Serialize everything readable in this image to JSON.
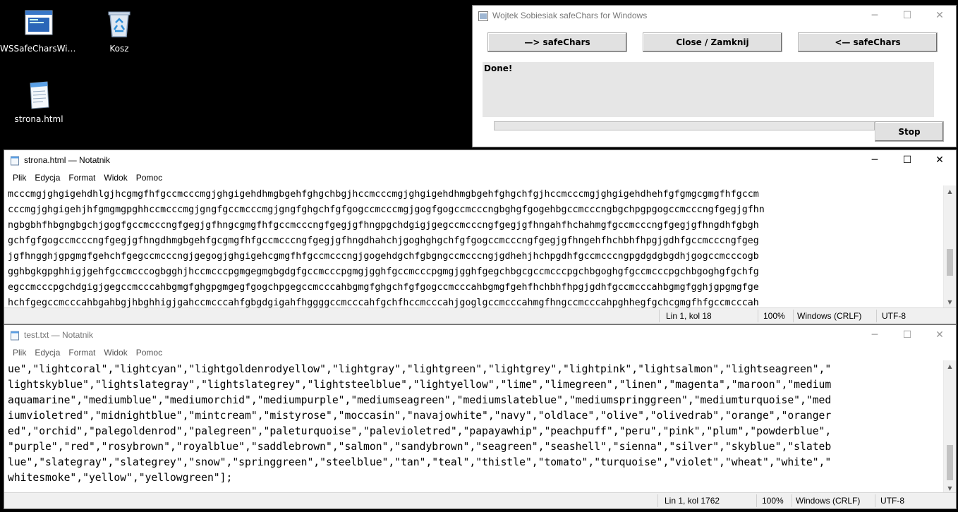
{
  "desktop": {
    "icons": [
      {
        "label": "WSSafeCharsWin...",
        "icon": "program-window-icon"
      },
      {
        "label": "Kosz",
        "icon": "recycle-bin-icon"
      },
      {
        "label": "strona.html",
        "icon": "notepad-document-icon"
      }
    ]
  },
  "safechars": {
    "title": "Wojtek Sobiesiak safeChars for Windows",
    "buttons": {
      "to_safe": "—> safeChars",
      "close": "Close / Zamknij",
      "from_safe": "<— safeChars"
    },
    "status": "Done!",
    "progress_fraction": 0.0,
    "stop_label": "Stop",
    "window_controls": {
      "minimize": "─",
      "maximize": "☐",
      "close": "✕"
    }
  },
  "notepad1": {
    "title": "strona.html — Notatnik",
    "menu": [
      "Plik",
      "Edycja",
      "Format",
      "Widok",
      "Pomoc"
    ],
    "lines": [
      "mcccmgjghgigehdhlgjhcgmgfhfgccmcccmgjghgigehdhmgbgehfghgchbgjhccmcccmgjghgigehdhmgbgehfghgchfgjhccmcccmgjghgigehdhehfgfgmgcgmgfhfgccm",
      "cccmgjghgigehjhfgmgmgpghhccmcccmgjgngfgccmcccmgjgngfghgchfgfgogccmcccmgjgogfgogccmcccngbghgfgogehbgccmcccngbgchpgpgogccmcccngfgegjgfhn",
      "ngbgbhfhbgngbgchjgogfgccmcccngfgegjgfhngcgmgfhfgccmcccngfgegjgfhngpgchdgigjgegccmcccngfgegjgfhngahfhchahmgfgccmcccngfgegjgfhngdhfgbgh",
      "gchfgfgogccmcccngfgegjgfhngdhmgbgehfgcgmgfhfgccmcccngfgegjgfhngdhahchjgoghghgchfgfgogccmcccngfgegjgfhngehfhchbhfhpgjgdhfgccmcccngfgeg",
      "jgfhngghjgpgmgfgehchfgegccmcccngjgegogjghgigehcgmgfhfgccmcccngjgogehdgchfgbgngccmcccngjgdhehjhchpgdhfgccmcccngpgdgdgbgdhjgogccmcccogb",
      "gghbgkgpghhigjgehfgccmcccogbgghjhccmcccpgmgegmgbgdgfgccmcccpgmgjgghfgccmcccpgmgjgghfgegchbgcgccmcccpgchbgoghgfgccmcccpgchbgoghgfgchfg",
      "egccmcccpgchdgigjgegccmcccahbgmgfghgpgmgegfgogchpgegccmcccahbgmgfghgchfgfgogccmcccahbgmgfgehfhchbhfhpgjgdhfgccmcccahbgmgfgghjgpgmgfge",
      "hchfgegccmcccahbgahbgjhbghhigjgahccmcccahfgbgdgigahfhggggccmcccahfgchfhccmcccahjgoglgccmcccahmgfhngccmcccahpghhegfgchcgmgfhfgccmcccah"
    ],
    "status": {
      "position": "Lin 1, kol 18",
      "zoom": "100%",
      "eol": "Windows (CRLF)",
      "encoding": "UTF-8"
    },
    "window_controls": {
      "minimize": "─",
      "maximize": "☐",
      "close": "✕"
    }
  },
  "notepad2": {
    "title": "test.txt — Notatnik",
    "menu": [
      "Plik",
      "Edycja",
      "Format",
      "Widok",
      "Pomoc"
    ],
    "lines": [
      "ue\",\"lightcoral\",\"lightcyan\",\"lightgoldenrodyellow\",\"lightgray\",\"lightgreen\",\"lightgrey\",\"lightpink\",\"lightsalmon\",\"lightseagreen\",\"",
      "lightskyblue\",\"lightslategray\",\"lightslategrey\",\"lightsteelblue\",\"lightyellow\",\"lime\",\"limegreen\",\"linen\",\"magenta\",\"maroon\",\"medium",
      "aquamarine\",\"mediumblue\",\"mediumorchid\",\"mediumpurple\",\"mediumseagreen\",\"mediumslateblue\",\"mediumspringgreen\",\"mediumturquoise\",\"med",
      "iumvioletred\",\"midnightblue\",\"mintcream\",\"mistyrose\",\"moccasin\",\"navajowhite\",\"navy\",\"oldlace\",\"olive\",\"olivedrab\",\"orange\",\"oranger",
      "ed\",\"orchid\",\"palegoldenrod\",\"palegreen\",\"paleturquoise\",\"palevioletred\",\"papayawhip\",\"peachpuff\",\"peru\",\"pink\",\"plum\",\"powderblue\",",
      "\"purple\",\"red\",\"rosybrown\",\"royalblue\",\"saddlebrown\",\"salmon\",\"sandybrown\",\"seagreen\",\"seashell\",\"sienna\",\"silver\",\"skyblue\",\"slateb",
      "lue\",\"slategray\",\"slategrey\",\"snow\",\"springgreen\",\"steelblue\",\"tan\",\"teal\",\"thistle\",\"tomato\",\"turquoise\",\"violet\",\"wheat\",\"white\",\"",
      "whitesmoke\",\"yellow\",\"yellowgreen\"];"
    ],
    "status": {
      "position": "Lin 1, kol 1762",
      "zoom": "100%",
      "eol": "Windows (CRLF)",
      "encoding": "UTF-8"
    },
    "window_controls": {
      "minimize": "─",
      "maximize": "☐",
      "close": "✕"
    }
  },
  "colors": {
    "desktop_bg": "#000000",
    "progress_green": "#06b025",
    "button_face": "#e1e1e1"
  }
}
